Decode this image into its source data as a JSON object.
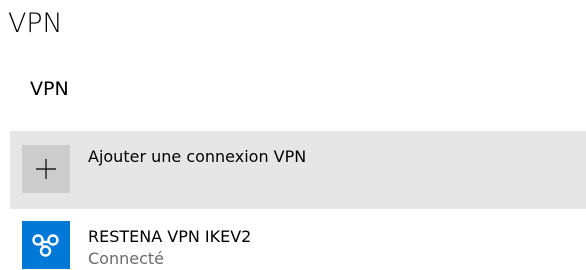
{
  "page": {
    "title": "VPN"
  },
  "section": {
    "title": "VPN"
  },
  "add_connection": {
    "label": "Ajouter une connexion VPN",
    "icon": "plus-icon"
  },
  "connections": [
    {
      "name": "RESTENA VPN IKEV2",
      "status": "Connecté",
      "icon": "vpn-key-icon",
      "icon_color": "#0078d7"
    }
  ],
  "colors": {
    "add_row_background": "#e6e6e6",
    "add_tile_background": "#cccccc",
    "status_text": "#6b6b6b"
  }
}
